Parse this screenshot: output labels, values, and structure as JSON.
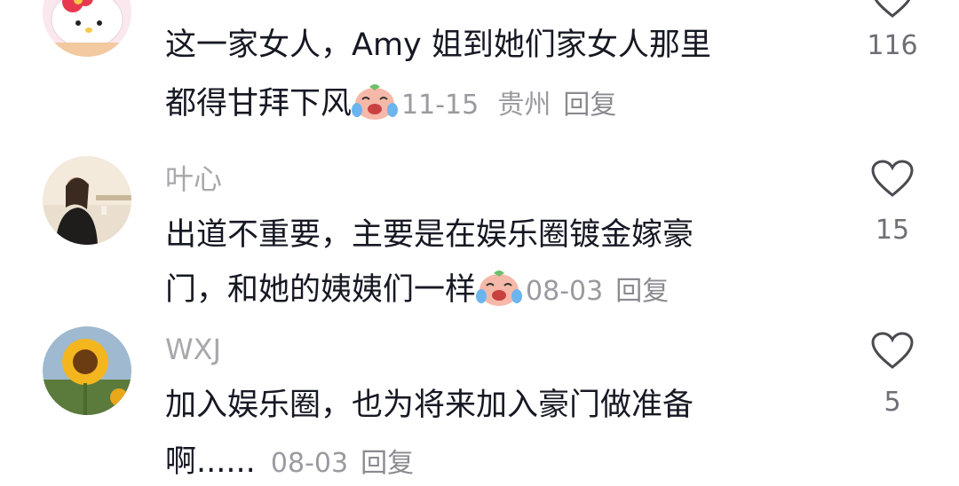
{
  "comments": [
    {
      "username": "",
      "lines": [
        "这一家女人，Amy 姐到她们家女人那里",
        "都得甘拜下风"
      ],
      "emoji": "crying-laughing-emoji",
      "date": "11-15",
      "location": "贵州",
      "reply_label": "回复",
      "likes": "116"
    },
    {
      "username": "叶心",
      "lines": [
        "出道不重要，主要是在娱乐圈镀金嫁豪",
        "门，和她的姨姨们一样"
      ],
      "emoji": "crying-laughing-emoji",
      "date": "08-03",
      "location": "",
      "reply_label": "回复",
      "likes": "15"
    },
    {
      "username": "WXJ",
      "lines": [
        "加入娱乐圈，也为将来加入豪门做准备",
        "啊......"
      ],
      "emoji": "",
      "date": "08-03",
      "location": "",
      "reply_label": "回复",
      "likes": "5"
    }
  ],
  "colors": {
    "text": "#161823",
    "meta": "#9a9aa0",
    "username": "#a8a8ac",
    "heart_outline": "#4a4a50"
  }
}
